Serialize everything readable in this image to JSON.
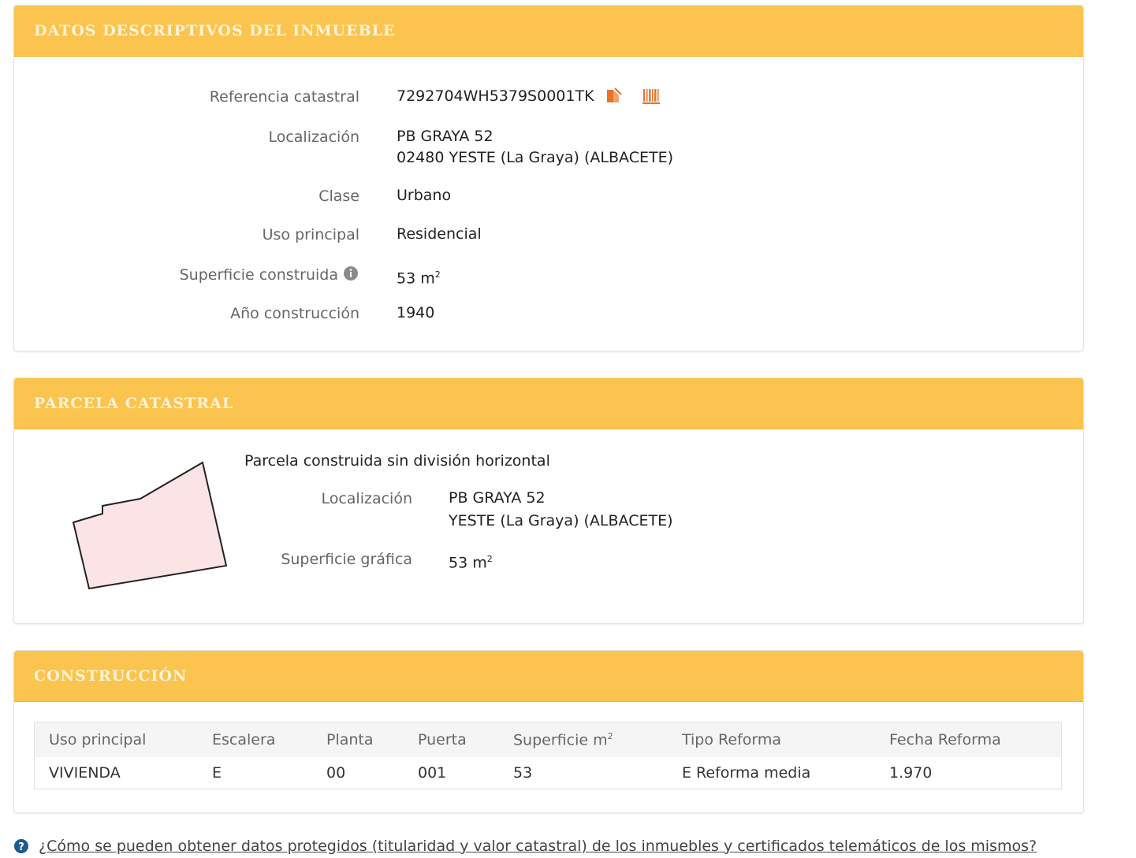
{
  "datos": {
    "title": "DATOS DESCRIPTIVOS DEL INMUEBLE",
    "ref_label": "Referencia catastral",
    "ref_value": "7292704WH5379S0001TK",
    "loc_label": "Localización",
    "loc_line1": "PB GRAYA 52",
    "loc_line2": "02480 YESTE (La Graya) (ALBACETE)",
    "clase_label": "Clase",
    "clase_value": "Urbano",
    "uso_label": "Uso principal",
    "uso_value": "Residencial",
    "sup_label": "Superficie construida",
    "sup_value": "53 m",
    "sup_exp": "2",
    "anio_label": "Año construcción",
    "anio_value": "1940"
  },
  "parcela": {
    "title": "PARCELA CATASTRAL",
    "subtitle": "Parcela construida sin división horizontal",
    "loc_label": "Localización",
    "loc_line1": "PB GRAYA 52",
    "loc_line2": "YESTE (La Graya) (ALBACETE)",
    "sup_label": "Superficie gráfica",
    "sup_value": "53 m",
    "sup_exp": "2",
    "shape_fill": "#fbe3e6"
  },
  "construccion": {
    "title": "CONSTRUCCIÓN",
    "headers": [
      "Uso principal",
      "Escalera",
      "Planta",
      "Puerta",
      "Superficie m",
      "Tipo Reforma",
      "Fecha Reforma"
    ],
    "sup_header_exp": "2",
    "rows": [
      [
        "VIVIENDA",
        "E",
        "00",
        "001",
        "53",
        "E Reforma media",
        "1.970"
      ]
    ]
  },
  "footer": {
    "text": "¿Cómo se pueden obtener datos protegidos (titularidad y valor catastral) de los inmuebles y certificados telemáticos de los mismos?"
  },
  "colors": {
    "header": "#fbc44e",
    "header_text": "#fdf3d8",
    "accent_icon": "#e8732a"
  }
}
